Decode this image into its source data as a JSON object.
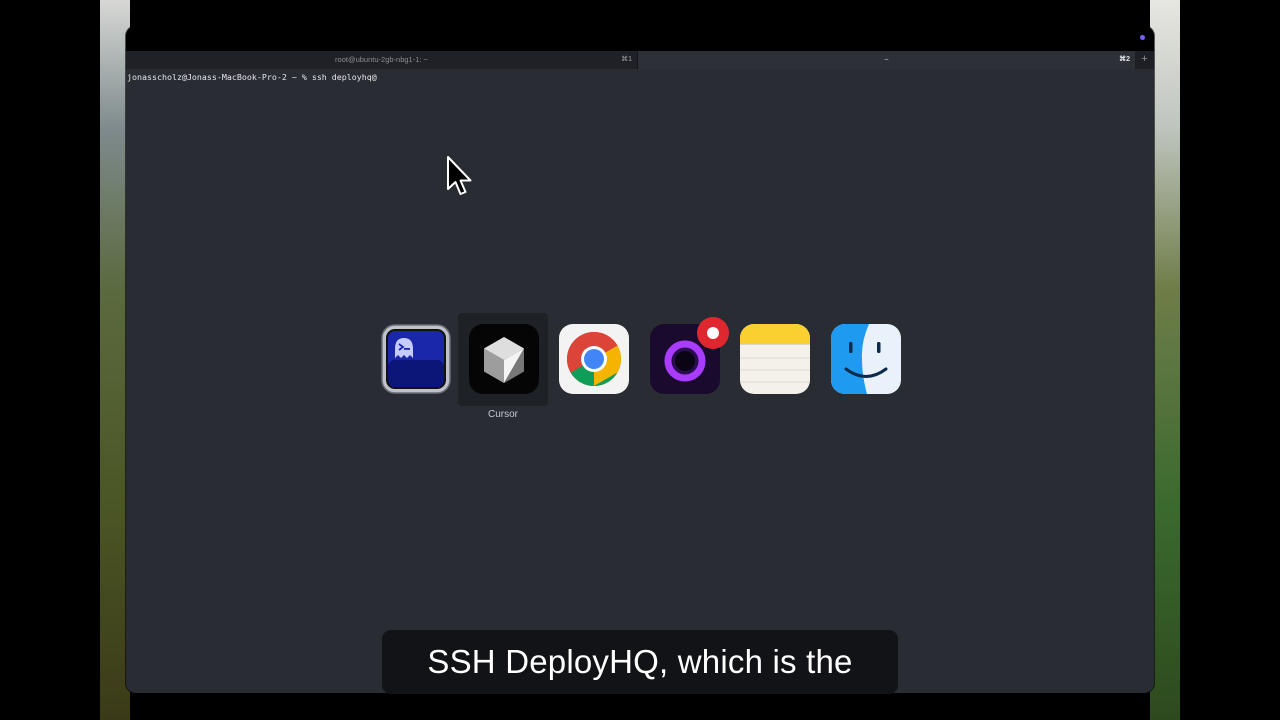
{
  "terminal": {
    "tabs": [
      {
        "title": "root@ubuntu-2gb-nbg1-1: ~",
        "shortcut": "⌘1"
      },
      {
        "title": "~",
        "shortcut": "⌘2"
      }
    ],
    "new_tab_label": "+",
    "prompt_line": "jonasscholz@Jonass-MacBook-Pro-2 ~ % ssh deployhq@"
  },
  "app_switcher": {
    "apps": [
      {
        "icon": "ghostty-terminal-icon",
        "label": ""
      },
      {
        "icon": "cursor-app-icon",
        "label": "Cursor",
        "selected": true
      },
      {
        "icon": "chrome-icon",
        "label": ""
      },
      {
        "icon": "recording-app-icon",
        "label": ""
      },
      {
        "icon": "notes-icon",
        "label": ""
      },
      {
        "icon": "finder-icon",
        "label": ""
      }
    ]
  },
  "subtitle": "SSH DeployHQ, which is the",
  "colors": {
    "terminal_bg": "#292c33",
    "accent_dot": "#7b5cff",
    "badge_red": "#e0262f"
  }
}
